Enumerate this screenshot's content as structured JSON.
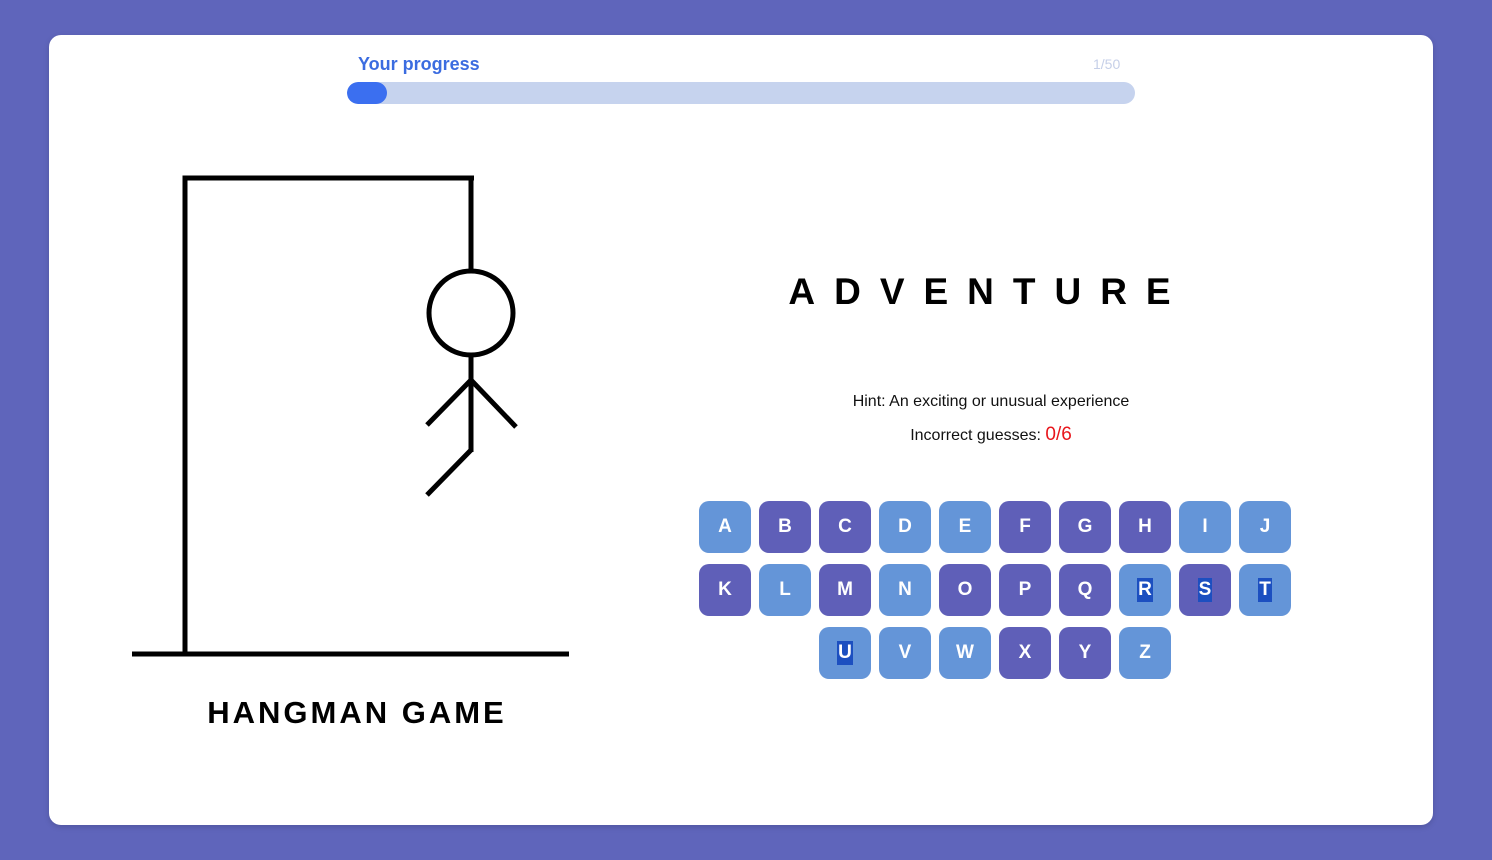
{
  "progress": {
    "label": "Your progress",
    "count_text": "1/50",
    "fraction": 0.02
  },
  "game": {
    "title": "HANGMAN GAME",
    "word": "ADVENTURE",
    "hint": "Hint: An exciting or unusual experience",
    "incorrect_label": "Incorrect guesses: ",
    "incorrect_count": "0/6"
  },
  "keyboard": {
    "keys": [
      {
        "letter": "A",
        "style": "light",
        "selected": false
      },
      {
        "letter": "B",
        "style": "dark",
        "selected": false
      },
      {
        "letter": "C",
        "style": "dark",
        "selected": false
      },
      {
        "letter": "D",
        "style": "light",
        "selected": false
      },
      {
        "letter": "E",
        "style": "light",
        "selected": false
      },
      {
        "letter": "F",
        "style": "dark",
        "selected": false
      },
      {
        "letter": "G",
        "style": "dark",
        "selected": false
      },
      {
        "letter": "H",
        "style": "dark",
        "selected": false
      },
      {
        "letter": "I",
        "style": "light",
        "selected": false
      },
      {
        "letter": "J",
        "style": "light",
        "selected": false
      },
      {
        "letter": "K",
        "style": "dark",
        "selected": false
      },
      {
        "letter": "L",
        "style": "light",
        "selected": false
      },
      {
        "letter": "M",
        "style": "dark",
        "selected": false
      },
      {
        "letter": "N",
        "style": "light",
        "selected": false
      },
      {
        "letter": "O",
        "style": "dark",
        "selected": false
      },
      {
        "letter": "P",
        "style": "dark",
        "selected": false
      },
      {
        "letter": "Q",
        "style": "dark",
        "selected": false
      },
      {
        "letter": "R",
        "style": "light",
        "selected": true
      },
      {
        "letter": "S",
        "style": "dark",
        "selected": true
      },
      {
        "letter": "T",
        "style": "light",
        "selected": true
      },
      {
        "letter": "U",
        "style": "light",
        "selected": true
      },
      {
        "letter": "V",
        "style": "light",
        "selected": false
      },
      {
        "letter": "W",
        "style": "light",
        "selected": false
      },
      {
        "letter": "X",
        "style": "dark",
        "selected": false
      },
      {
        "letter": "Y",
        "style": "dark",
        "selected": false
      },
      {
        "letter": "Z",
        "style": "light",
        "selected": false
      }
    ]
  },
  "colors": {
    "background": "#5f65bb",
    "key_light": "#6495d8",
    "key_dark": "#5f5fb8",
    "progress_fill": "#3b6ff0",
    "progress_track": "#c6d3ee",
    "incorrect_count": "#e8151b"
  }
}
